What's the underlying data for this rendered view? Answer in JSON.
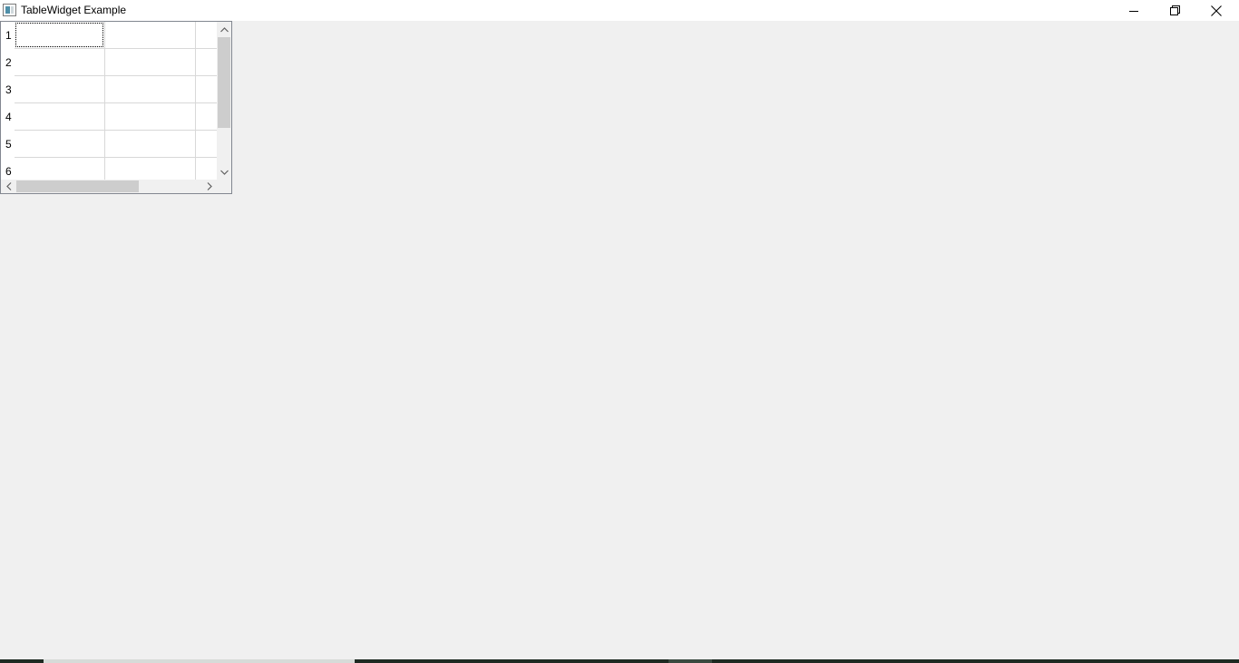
{
  "window": {
    "title": "TableWidget Example",
    "icon": "app-window-icon"
  },
  "title_buttons": {
    "minimize": "minimize-icon",
    "maximize": "restore-icon",
    "close": "close-icon"
  },
  "table": {
    "row_headers": [
      "1",
      "2",
      "3",
      "4",
      "5",
      "6"
    ],
    "visible_columns": 3,
    "current_cell": {
      "row": 1,
      "column": 1
    },
    "cell_values": [
      [
        "",
        "",
        ""
      ],
      [
        "",
        "",
        ""
      ],
      [
        "",
        "",
        ""
      ],
      [
        "",
        "",
        ""
      ],
      [
        "",
        "",
        ""
      ],
      [
        "",
        "",
        ""
      ]
    ]
  },
  "colors": {
    "window_bg": "#f0f0f0",
    "titlebar_bg": "#ffffff",
    "grid_line": "#d8d8d8",
    "scroll_thumb": "#cdcdcd",
    "frame_border": "#828790"
  }
}
